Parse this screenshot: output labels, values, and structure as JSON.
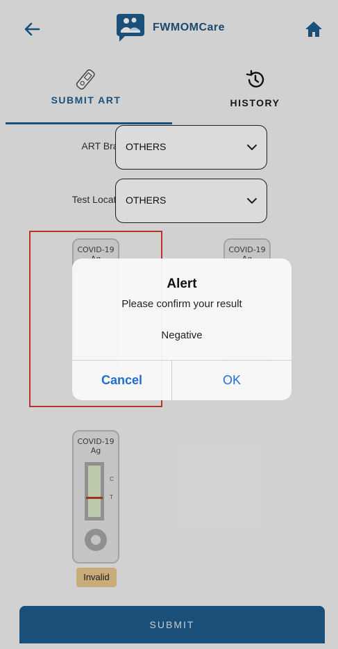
{
  "header": {
    "app_name": "FWMOMCare",
    "back_icon": "arrow-left-icon",
    "home_icon": "home-icon",
    "accent_color": "#1b5f8f"
  },
  "tabs": [
    {
      "label": "SUBMIT ART",
      "icon": "test-kit-icon",
      "active": true
    },
    {
      "label": "HISTORY",
      "icon": "history-icon",
      "active": false
    }
  ],
  "form": {
    "art_brand_label": "ART Brand:",
    "art_brand_value": "OTHERS",
    "test_location_label": "Test Location:",
    "test_location_value": "OTHERS"
  },
  "test_cards": [
    {
      "title_line1": "COVID-19",
      "title_line2": "Ag",
      "selected": true
    },
    {
      "title_line1": "COVID-19",
      "title_line2": "Ag",
      "selected": false
    },
    {
      "title_line1": "COVID-19",
      "title_line2": "Ag",
      "c_label": "C",
      "t_label": "T",
      "result": "Invalid",
      "selected": false
    }
  ],
  "alert": {
    "title": "Alert",
    "message": "Please confirm your result",
    "result": "Negative",
    "cancel_label": "Cancel",
    "ok_label": "OK"
  },
  "submit_label": "SUBMIT",
  "colors": {
    "selection_border": "#d93b30",
    "invalid_badge": "#e9c98f",
    "submit_bg": "#1e5d8c",
    "dialog_button": "#1f6cd1"
  }
}
